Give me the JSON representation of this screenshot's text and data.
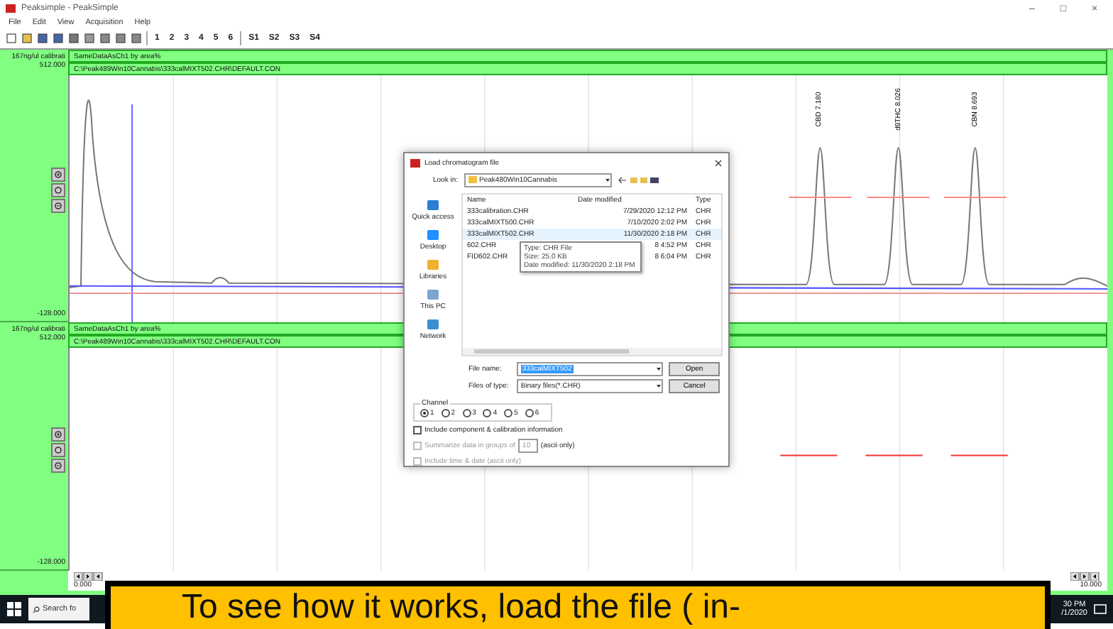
{
  "window": {
    "title": "Peaksimple - PeakSimple",
    "controls": [
      "–",
      "□",
      "×"
    ]
  },
  "menu": [
    "File",
    "Edit",
    "View",
    "Acquisition",
    "Help"
  ],
  "toolbar": {
    "channels": [
      "1",
      "2",
      "3",
      "4",
      "5",
      "6"
    ],
    "series": [
      "S1",
      "S2",
      "S3",
      "S4"
    ]
  },
  "panels": [
    {
      "label": "167ng/ul calibrati",
      "y_max": "512.000",
      "y_min": "-128.000",
      "method": "SameDataAsCh1 by area%",
      "path": "C:\\Peak489Win10Cannabis\\333calMIXT502.CHR\\DEFAULT.CON",
      "peaks": [
        {
          "label": "CBD 7.180"
        },
        {
          "label": "d9THC 8.026"
        },
        {
          "label": "CBN 8.693"
        }
      ]
    },
    {
      "label": "167ng/ul calibrati",
      "y_max": "512.000",
      "y_min": "-128.000",
      "method": "SameDataAsCh1 by area%",
      "path": "C:\\Peak489Win10Cannabis\\333calMIXT502.CHR\\DEFAULT.CON",
      "x_min": "0.000",
      "x_max": "10.000"
    }
  ],
  "dialog": {
    "title": "Load chromatogram file",
    "look_in_label": "Look in:",
    "folder": "Peak480Win10Cannabis",
    "places": [
      "Quick access",
      "Desktop",
      "Libraries",
      "This PC",
      "Network"
    ],
    "columns": [
      "Name",
      "Date modified",
      "Type"
    ],
    "files": [
      {
        "name": "333calibration.CHR",
        "date": "7/29/2020 12:12 PM",
        "type": "CHR",
        "selected": false
      },
      {
        "name": "333calMIXT500.CHR",
        "date": "7/10/2020 2:02 PM",
        "type": "CHR",
        "selected": false
      },
      {
        "name": "333calMIXT502.CHR",
        "date": "11/30/2020 2:18 PM",
        "type": "CHR",
        "selected": true
      },
      {
        "name": "602.CHR",
        "date": "8 4:52 PM",
        "type": "CHR",
        "selected": false
      },
      {
        "name": "FID602.CHR",
        "date": "8 6:04 PM",
        "type": "CHR",
        "selected": false
      }
    ],
    "tooltip": [
      "Type: CHR File",
      "Size: 25.0 KB",
      "Date modified: 11/30/2020 2:18 PM"
    ],
    "file_name_label": "File name:",
    "file_name": "333calMIXT502",
    "file_type_label": "Files of type:",
    "file_type": "Binary files(*.CHR)",
    "buttons": [
      "Open",
      "Cancel"
    ],
    "channel_label": "Channel",
    "channels": [
      {
        "label": "1",
        "selected": true
      },
      {
        "label": "2",
        "selected": false
      },
      {
        "label": "3",
        "selected": false
      },
      {
        "label": "4",
        "selected": false
      },
      {
        "label": "5",
        "selected": false
      },
      {
        "label": "6",
        "selected": false
      }
    ],
    "options": [
      {
        "label": "Include component & calibration information",
        "checked": false,
        "disabled": false
      },
      {
        "label": "Summarize data in groups of",
        "checked": false,
        "disabled": true,
        "value": "10",
        "note": "(ascii only)"
      },
      {
        "label": "Include time & date (ascii only)",
        "checked": false,
        "disabled": true
      }
    ]
  },
  "taskbar": {
    "search": "Search fo",
    "time": "30 PM",
    "date": "/1/2020"
  },
  "caption": "To see how it works, load the file ( in-"
}
